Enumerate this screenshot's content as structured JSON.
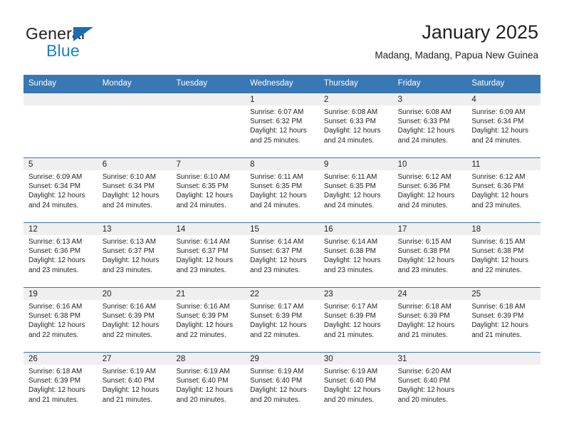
{
  "brand": {
    "name_part1": "General",
    "name_part2": "Blue",
    "triangle_color": "#1d6cb3",
    "blue_color": "#1c7fd4"
  },
  "header": {
    "title": "January 2025",
    "subtitle": "Madang, Madang, Papua New Guinea"
  },
  "theme": {
    "header_blue": "#3878b4",
    "daynum_band": "#efefef",
    "text": "#231f20"
  },
  "weekdays": [
    "Sunday",
    "Monday",
    "Tuesday",
    "Wednesday",
    "Thursday",
    "Friday",
    "Saturday"
  ],
  "weeks": [
    [
      {
        "day": "",
        "sunrise": "",
        "sunset": "",
        "daylight1": "",
        "daylight2": ""
      },
      {
        "day": "",
        "sunrise": "",
        "sunset": "",
        "daylight1": "",
        "daylight2": ""
      },
      {
        "day": "",
        "sunrise": "",
        "sunset": "",
        "daylight1": "",
        "daylight2": ""
      },
      {
        "day": "1",
        "sunrise": "Sunrise: 6:07 AM",
        "sunset": "Sunset: 6:32 PM",
        "daylight1": "Daylight: 12 hours",
        "daylight2": "and 25 minutes."
      },
      {
        "day": "2",
        "sunrise": "Sunrise: 6:08 AM",
        "sunset": "Sunset: 6:33 PM",
        "daylight1": "Daylight: 12 hours",
        "daylight2": "and 24 minutes."
      },
      {
        "day": "3",
        "sunrise": "Sunrise: 6:08 AM",
        "sunset": "Sunset: 6:33 PM",
        "daylight1": "Daylight: 12 hours",
        "daylight2": "and 24 minutes."
      },
      {
        "day": "4",
        "sunrise": "Sunrise: 6:09 AM",
        "sunset": "Sunset: 6:34 PM",
        "daylight1": "Daylight: 12 hours",
        "daylight2": "and 24 minutes."
      }
    ],
    [
      {
        "day": "5",
        "sunrise": "Sunrise: 6:09 AM",
        "sunset": "Sunset: 6:34 PM",
        "daylight1": "Daylight: 12 hours",
        "daylight2": "and 24 minutes."
      },
      {
        "day": "6",
        "sunrise": "Sunrise: 6:10 AM",
        "sunset": "Sunset: 6:34 PM",
        "daylight1": "Daylight: 12 hours",
        "daylight2": "and 24 minutes."
      },
      {
        "day": "7",
        "sunrise": "Sunrise: 6:10 AM",
        "sunset": "Sunset: 6:35 PM",
        "daylight1": "Daylight: 12 hours",
        "daylight2": "and 24 minutes."
      },
      {
        "day": "8",
        "sunrise": "Sunrise: 6:11 AM",
        "sunset": "Sunset: 6:35 PM",
        "daylight1": "Daylight: 12 hours",
        "daylight2": "and 24 minutes."
      },
      {
        "day": "9",
        "sunrise": "Sunrise: 6:11 AM",
        "sunset": "Sunset: 6:35 PM",
        "daylight1": "Daylight: 12 hours",
        "daylight2": "and 24 minutes."
      },
      {
        "day": "10",
        "sunrise": "Sunrise: 6:12 AM",
        "sunset": "Sunset: 6:36 PM",
        "daylight1": "Daylight: 12 hours",
        "daylight2": "and 24 minutes."
      },
      {
        "day": "11",
        "sunrise": "Sunrise: 6:12 AM",
        "sunset": "Sunset: 6:36 PM",
        "daylight1": "Daylight: 12 hours",
        "daylight2": "and 23 minutes."
      }
    ],
    [
      {
        "day": "12",
        "sunrise": "Sunrise: 6:13 AM",
        "sunset": "Sunset: 6:36 PM",
        "daylight1": "Daylight: 12 hours",
        "daylight2": "and 23 minutes."
      },
      {
        "day": "13",
        "sunrise": "Sunrise: 6:13 AM",
        "sunset": "Sunset: 6:37 PM",
        "daylight1": "Daylight: 12 hours",
        "daylight2": "and 23 minutes."
      },
      {
        "day": "14",
        "sunrise": "Sunrise: 6:14 AM",
        "sunset": "Sunset: 6:37 PM",
        "daylight1": "Daylight: 12 hours",
        "daylight2": "and 23 minutes."
      },
      {
        "day": "15",
        "sunrise": "Sunrise: 6:14 AM",
        "sunset": "Sunset: 6:37 PM",
        "daylight1": "Daylight: 12 hours",
        "daylight2": "and 23 minutes."
      },
      {
        "day": "16",
        "sunrise": "Sunrise: 6:14 AM",
        "sunset": "Sunset: 6:38 PM",
        "daylight1": "Daylight: 12 hours",
        "daylight2": "and 23 minutes."
      },
      {
        "day": "17",
        "sunrise": "Sunrise: 6:15 AM",
        "sunset": "Sunset: 6:38 PM",
        "daylight1": "Daylight: 12 hours",
        "daylight2": "and 23 minutes."
      },
      {
        "day": "18",
        "sunrise": "Sunrise: 6:15 AM",
        "sunset": "Sunset: 6:38 PM",
        "daylight1": "Daylight: 12 hours",
        "daylight2": "and 22 minutes."
      }
    ],
    [
      {
        "day": "19",
        "sunrise": "Sunrise: 6:16 AM",
        "sunset": "Sunset: 6:38 PM",
        "daylight1": "Daylight: 12 hours",
        "daylight2": "and 22 minutes."
      },
      {
        "day": "20",
        "sunrise": "Sunrise: 6:16 AM",
        "sunset": "Sunset: 6:39 PM",
        "daylight1": "Daylight: 12 hours",
        "daylight2": "and 22 minutes."
      },
      {
        "day": "21",
        "sunrise": "Sunrise: 6:16 AM",
        "sunset": "Sunset: 6:39 PM",
        "daylight1": "Daylight: 12 hours",
        "daylight2": "and 22 minutes."
      },
      {
        "day": "22",
        "sunrise": "Sunrise: 6:17 AM",
        "sunset": "Sunset: 6:39 PM",
        "daylight1": "Daylight: 12 hours",
        "daylight2": "and 22 minutes."
      },
      {
        "day": "23",
        "sunrise": "Sunrise: 6:17 AM",
        "sunset": "Sunset: 6:39 PM",
        "daylight1": "Daylight: 12 hours",
        "daylight2": "and 21 minutes."
      },
      {
        "day": "24",
        "sunrise": "Sunrise: 6:18 AM",
        "sunset": "Sunset: 6:39 PM",
        "daylight1": "Daylight: 12 hours",
        "daylight2": "and 21 minutes."
      },
      {
        "day": "25",
        "sunrise": "Sunrise: 6:18 AM",
        "sunset": "Sunset: 6:39 PM",
        "daylight1": "Daylight: 12 hours",
        "daylight2": "and 21 minutes."
      }
    ],
    [
      {
        "day": "26",
        "sunrise": "Sunrise: 6:18 AM",
        "sunset": "Sunset: 6:39 PM",
        "daylight1": "Daylight: 12 hours",
        "daylight2": "and 21 minutes."
      },
      {
        "day": "27",
        "sunrise": "Sunrise: 6:19 AM",
        "sunset": "Sunset: 6:40 PM",
        "daylight1": "Daylight: 12 hours",
        "daylight2": "and 21 minutes."
      },
      {
        "day": "28",
        "sunrise": "Sunrise: 6:19 AM",
        "sunset": "Sunset: 6:40 PM",
        "daylight1": "Daylight: 12 hours",
        "daylight2": "and 20 minutes."
      },
      {
        "day": "29",
        "sunrise": "Sunrise: 6:19 AM",
        "sunset": "Sunset: 6:40 PM",
        "daylight1": "Daylight: 12 hours",
        "daylight2": "and 20 minutes."
      },
      {
        "day": "30",
        "sunrise": "Sunrise: 6:19 AM",
        "sunset": "Sunset: 6:40 PM",
        "daylight1": "Daylight: 12 hours",
        "daylight2": "and 20 minutes."
      },
      {
        "day": "31",
        "sunrise": "Sunrise: 6:20 AM",
        "sunset": "Sunset: 6:40 PM",
        "daylight1": "Daylight: 12 hours",
        "daylight2": "and 20 minutes."
      },
      {
        "day": "",
        "sunrise": "",
        "sunset": "",
        "daylight1": "",
        "daylight2": ""
      }
    ]
  ]
}
